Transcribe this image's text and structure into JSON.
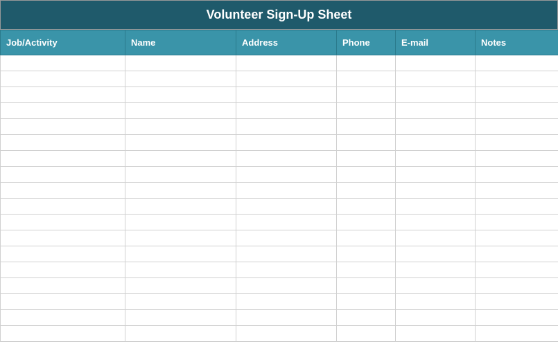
{
  "title": "Volunteer Sign-Up Sheet",
  "columns": [
    {
      "label": "Job/Activity",
      "class": "col-job"
    },
    {
      "label": "Name",
      "class": "col-name"
    },
    {
      "label": "Address",
      "class": "col-address"
    },
    {
      "label": "Phone",
      "class": "col-phone"
    },
    {
      "label": "E-mail",
      "class": "col-email"
    },
    {
      "label": "Notes",
      "class": "col-notes"
    }
  ],
  "rows": [
    [
      "",
      "",
      "",
      "",
      "",
      ""
    ],
    [
      "",
      "",
      "",
      "",
      "",
      ""
    ],
    [
      "",
      "",
      "",
      "",
      "",
      ""
    ],
    [
      "",
      "",
      "",
      "",
      "",
      ""
    ],
    [
      "",
      "",
      "",
      "",
      "",
      ""
    ],
    [
      "",
      "",
      "",
      "",
      "",
      ""
    ],
    [
      "",
      "",
      "",
      "",
      "",
      ""
    ],
    [
      "",
      "",
      "",
      "",
      "",
      ""
    ],
    [
      "",
      "",
      "",
      "",
      "",
      ""
    ],
    [
      "",
      "",
      "",
      "",
      "",
      ""
    ],
    [
      "",
      "",
      "",
      "",
      "",
      ""
    ],
    [
      "",
      "",
      "",
      "",
      "",
      ""
    ],
    [
      "",
      "",
      "",
      "",
      "",
      ""
    ],
    [
      "",
      "",
      "",
      "",
      "",
      ""
    ],
    [
      "",
      "",
      "",
      "",
      "",
      ""
    ],
    [
      "",
      "",
      "",
      "",
      "",
      ""
    ],
    [
      "",
      "",
      "",
      "",
      "",
      ""
    ],
    [
      "",
      "",
      "",
      "",
      "",
      ""
    ]
  ]
}
